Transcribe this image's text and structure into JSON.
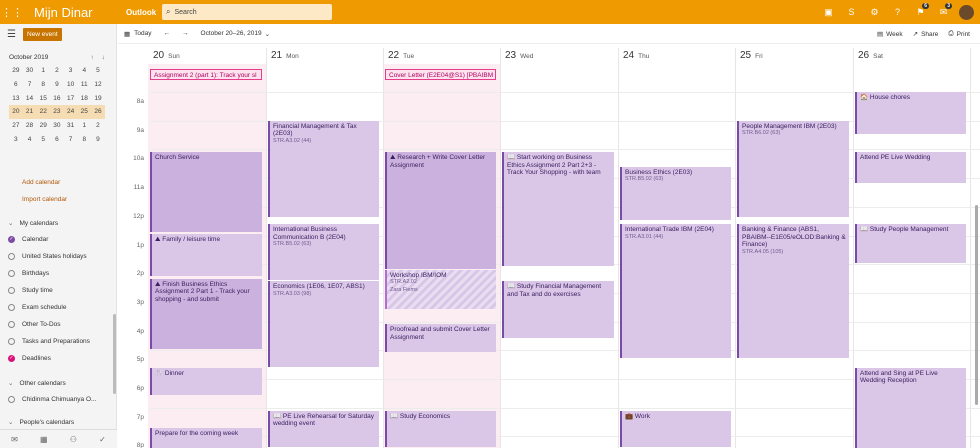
{
  "app": {
    "brand": "Mijn Dinar",
    "product": "Outlook",
    "search_placeholder": "Search",
    "badges": [
      "6",
      "3"
    ]
  },
  "left": {
    "new_event": "New event",
    "month": "October 2019",
    "weeks": [
      [
        "29",
        "30",
        "1",
        "2",
        "3",
        "4",
        "5"
      ],
      [
        "6",
        "7",
        "8",
        "9",
        "10",
        "11",
        "12"
      ],
      [
        "13",
        "14",
        "15",
        "16",
        "17",
        "18",
        "19"
      ],
      [
        "20",
        "21",
        "22",
        "23",
        "24",
        "25",
        "26"
      ],
      [
        "27",
        "28",
        "29",
        "30",
        "31",
        "1",
        "2"
      ],
      [
        "3",
        "4",
        "5",
        "6",
        "7",
        "8",
        "9"
      ]
    ],
    "add_calendar": "Add calendar",
    "import_calendar": "Import calendar",
    "my_calendars": "My calendars",
    "calendars": [
      "Calendar",
      "United States holidays",
      "Birthdays",
      "Study time",
      "Exam schedule",
      "Other To-Dos",
      "Tasks and Preparations",
      "Deadlines"
    ],
    "other_calendars": "Other calendars",
    "other_items": [
      "Chidinma Chimuanya O..."
    ],
    "peoples_calendars": "People's calendars"
  },
  "cmd": {
    "today": "Today",
    "range": "October 20–26, 2019",
    "view": "Week",
    "share": "Share",
    "print": "Print"
  },
  "days": [
    {
      "num": "20",
      "name": "Sun"
    },
    {
      "num": "21",
      "name": "Mon"
    },
    {
      "num": "22",
      "name": "Tue"
    },
    {
      "num": "23",
      "name": "Wed"
    },
    {
      "num": "24",
      "name": "Thu"
    },
    {
      "num": "25",
      "name": "Fri"
    },
    {
      "num": "26",
      "name": "Sat"
    }
  ],
  "allday": [
    {
      "day": 0,
      "text": "Assignment 2 (part 1): Track your sl"
    },
    {
      "day": 2,
      "text": "Cover Letter (E2E04@S1) [PBAIBM"
    }
  ],
  "hours": [
    "8a",
    "9a",
    "10a",
    "11a",
    "12p",
    "1p",
    "2p",
    "3p",
    "4p",
    "5p",
    "6p",
    "7p",
    "8p"
  ],
  "events": [
    {
      "day": 0,
      "s": 10.1,
      "e": 12.9,
      "title": "Church Service",
      "sub": "",
      "dk": true
    },
    {
      "day": 0,
      "s": 12.95,
      "e": 14.45,
      "title": "⛰ Family / leisure time",
      "sub": ""
    },
    {
      "day": 0,
      "s": 14.5,
      "e": 17.0,
      "title": "⛰ Finish Business Ethics Assignment 2 Part 1 - Track your shopping - and submit",
      "sub": "",
      "dk": true
    },
    {
      "day": 0,
      "s": 17.6,
      "e": 18.6,
      "title": "🍴 Dinner",
      "sub": ""
    },
    {
      "day": 0,
      "s": 19.7,
      "e": 20.5,
      "title": "Prepare for the coming week",
      "sub": ""
    },
    {
      "day": 1,
      "s": 9.0,
      "e": 12.4,
      "title": "Financial Management & Tax (2E03)",
      "sub": "STR.A3.02 (44)"
    },
    {
      "day": 1,
      "s": 12.6,
      "e": 14.6,
      "title": "International Business Communication B (2E04)",
      "sub": "STR.B5.02 (63)"
    },
    {
      "day": 1,
      "s": 14.6,
      "e": 17.6,
      "title": "Economics (1E06, 1E07, ABS1)",
      "sub": "STR.A3.03 (98)"
    },
    {
      "day": 1,
      "s": 19.1,
      "e": 20.4,
      "title": "📖 PE Live Rehearsal for Saturday wedding event",
      "sub": ""
    },
    {
      "day": 2,
      "s": 10.1,
      "e": 14.2,
      "title": "⛰ Research + Write Cover Letter Assignment",
      "sub": "",
      "dk": true
    },
    {
      "day": 2,
      "s": 14.2,
      "e": 15.6,
      "title": "Workshop IBM/IOM",
      "sub": "STR.A2.02",
      "sub2": "Zara Fiems",
      "pat": true
    },
    {
      "day": 2,
      "s": 16.1,
      "e": 17.1,
      "title": "Proofread and submit Cover Letter Assignment",
      "sub": ""
    },
    {
      "day": 2,
      "s": 19.1,
      "e": 20.4,
      "title": "📖 Study Economics",
      "sub": ""
    },
    {
      "day": 3,
      "s": 10.1,
      "e": 14.1,
      "title": "📖 Start working on Business Ethics Assignment 2 Part 2+3 - Track Your Shopping - with team",
      "sub": ""
    },
    {
      "day": 3,
      "s": 14.6,
      "e": 16.6,
      "title": "📖 Study Financial Management and Tax and do exercises",
      "sub": ""
    },
    {
      "day": 4,
      "s": 10.6,
      "e": 12.5,
      "title": "Business Ethics (2E03)",
      "sub": "STR.B5.02 (63)"
    },
    {
      "day": 4,
      "s": 12.6,
      "e": 17.3,
      "title": "International Trade IBM (2E04)",
      "sub": "STR.A3.01 (44)"
    },
    {
      "day": 4,
      "s": 19.1,
      "e": 20.4,
      "title": "💼 Work",
      "sub": ""
    },
    {
      "day": 5,
      "s": 9.0,
      "e": 12.4,
      "title": "People Management IBM (2E03)",
      "sub": "STR.B6.02 (63)"
    },
    {
      "day": 5,
      "s": 12.6,
      "e": 17.3,
      "title": "Banking & Finance (ABS1, PBAIBM--E1E05/eOLOD:Banking & Finance)",
      "sub": "STR.A4.05 (105)"
    },
    {
      "day": 6,
      "s": 8.0,
      "e": 9.5,
      "title": "🏠 House chores",
      "sub": ""
    },
    {
      "day": 6,
      "s": 10.1,
      "e": 11.2,
      "title": "Attend PE Live Wedding",
      "sub": ""
    },
    {
      "day": 6,
      "s": 12.6,
      "e": 14.0,
      "title": "📖 Study People Management",
      "sub": ""
    },
    {
      "day": 6,
      "s": 17.6,
      "e": 20.5,
      "title": "Attend and Sing at PE Live Wedding Reception",
      "sub": ""
    }
  ]
}
